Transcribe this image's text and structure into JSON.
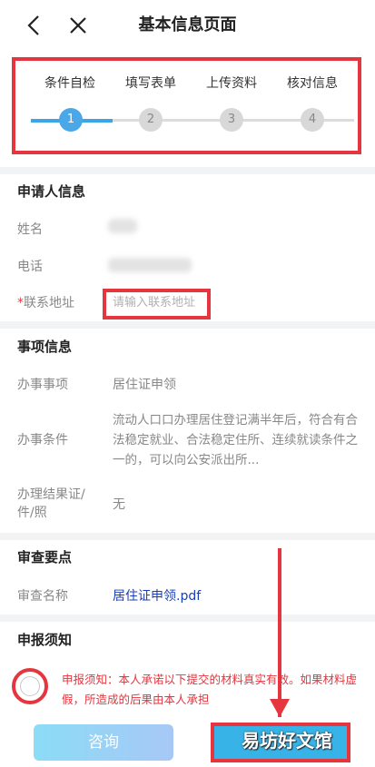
{
  "nav": {
    "title": "基本信息页面"
  },
  "steps": {
    "items": [
      {
        "label": "条件自检",
        "num": "1"
      },
      {
        "label": "填写表单",
        "num": "2"
      },
      {
        "label": "上传资料",
        "num": "3"
      },
      {
        "label": "核对信息",
        "num": "4"
      }
    ],
    "active_index": 0
  },
  "applicant": {
    "title": "申请人信息",
    "name_label": "姓名",
    "phone_label": "电话",
    "required_mark": "*",
    "address_label": "联系地址",
    "address_placeholder": "请输入联系地址"
  },
  "matter": {
    "title": "事项信息",
    "item_label": "办事事项",
    "item_value": "居住证申领",
    "cond_label": "办事条件",
    "cond_value": "流动人口口办理居住登记满半年后，符合有合法稳定就业、合法稳定住所、连续就读条件之一的，可以向公安派出所...",
    "result_label": "办理结果证/件/照",
    "result_value": "无"
  },
  "review": {
    "title": "审查要点",
    "name_label": "审查名称",
    "file_link": "居住证申领.pdf"
  },
  "declaration": {
    "title": "申报须知",
    "text": "申报须知：本人承诺以下提交的材料真实有效。如果材料虚假，所造成的后果由本人承担"
  },
  "bottom": {
    "consult_label": "咨询",
    "watermark": "易坊好文馆"
  },
  "colors": {
    "accent": "#3aa6e6",
    "highlight": "#e5353e",
    "link": "#1a3fb4"
  }
}
